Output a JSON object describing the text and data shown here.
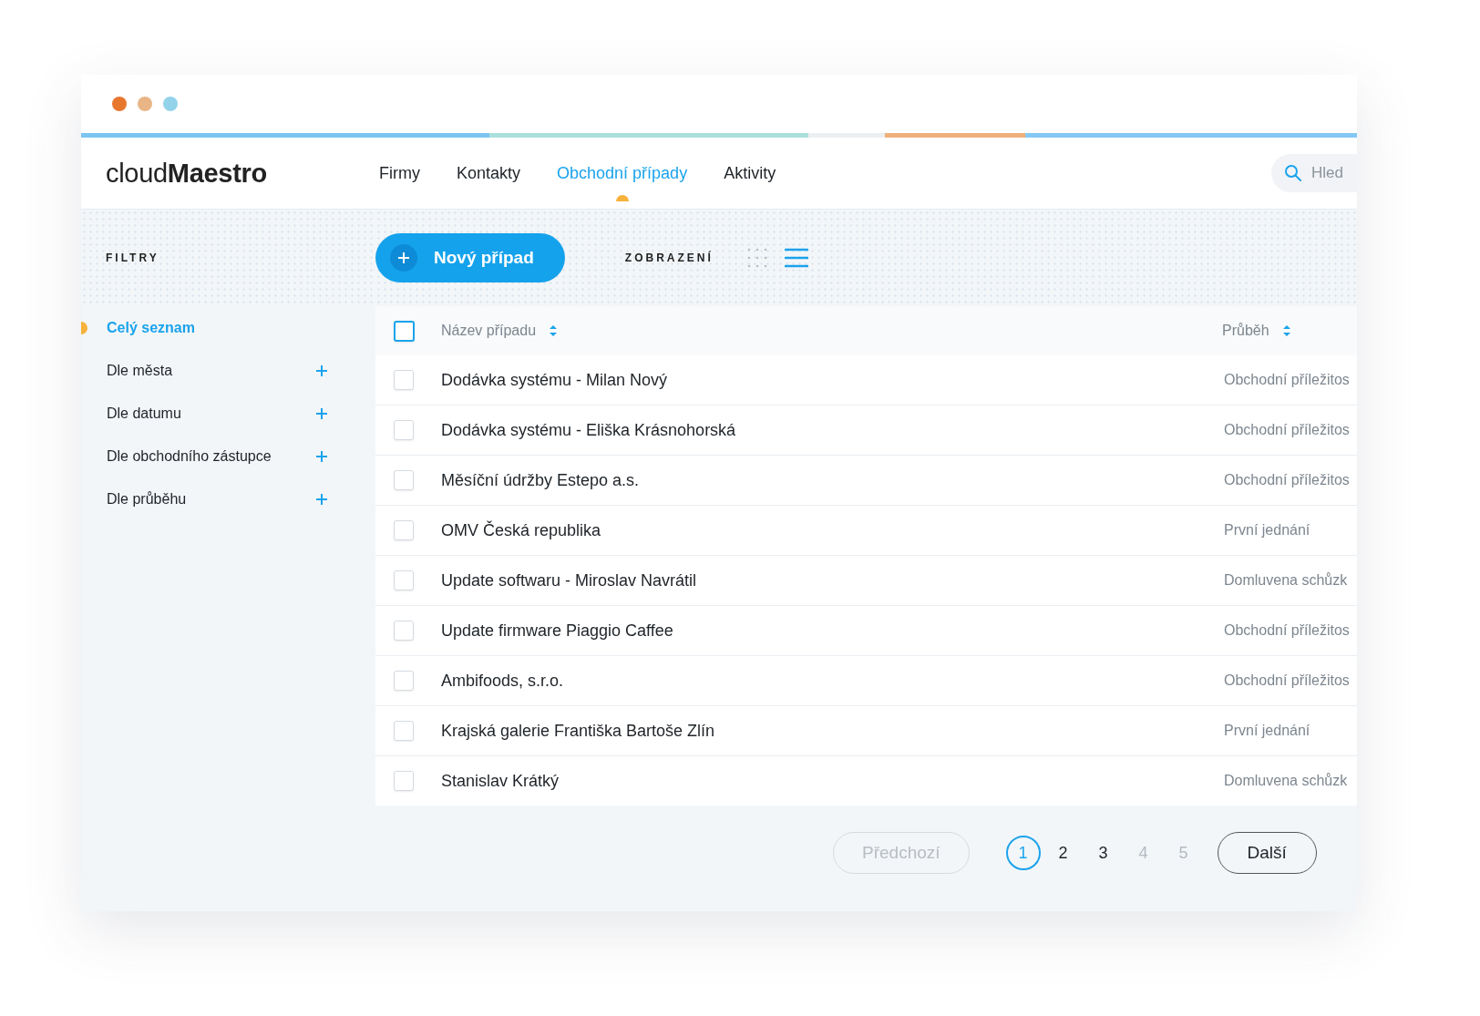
{
  "window": {
    "controls": [
      {
        "color": "#e8772e"
      },
      {
        "color": "#e9b587"
      },
      {
        "color": "#93d3ea"
      }
    ]
  },
  "header": {
    "logo_light": "cloud",
    "logo_bold": "Maestro",
    "nav": [
      {
        "label": "Firmy",
        "selected": false
      },
      {
        "label": "Kontakty",
        "selected": false
      },
      {
        "label": "Obchodní případy",
        "selected": true
      },
      {
        "label": "Aktivity",
        "selected": false
      }
    ],
    "search": {
      "placeholder": "Hled"
    }
  },
  "toolbar": {
    "filters_title": "FILTRY",
    "new_button": "Nový případ",
    "view_label": "ZOBRAZENÍ",
    "views": [
      {
        "kind": "grid",
        "selected": false
      },
      {
        "kind": "list",
        "selected": true
      }
    ]
  },
  "sidebar": {
    "items": [
      {
        "label": "Celý seznam",
        "kind": "all",
        "selected": true
      },
      {
        "label": "Dle města",
        "kind": "group",
        "selected": false
      },
      {
        "label": "Dle datumu",
        "kind": "group",
        "selected": false
      },
      {
        "label": "Dle obchodního zástupce",
        "kind": "group",
        "selected": false
      },
      {
        "label": "Dle průběhu",
        "kind": "group",
        "selected": false
      }
    ]
  },
  "table": {
    "select_all_checked": false,
    "columns": [
      "Název případu",
      "Průběh"
    ],
    "rows": [
      {
        "name": "Dodávka systému - Milan Nový",
        "progress": "Obchodní příležitos",
        "checked": false
      },
      {
        "name": "Dodávka systému - Eliška Krásnohorská",
        "progress": "Obchodní příležitos",
        "checked": false
      },
      {
        "name": "Měsíční údržby Estepo a.s.",
        "progress": "Obchodní příležitos",
        "checked": false
      },
      {
        "name": "OMV Česká republika",
        "progress": "První jednání",
        "checked": false
      },
      {
        "name": "Update softwaru - Miroslav Navrátil",
        "progress": "Domluvena schůzk",
        "checked": false
      },
      {
        "name": "Update firmware Piaggio Caffee",
        "progress": "Obchodní příležitos",
        "checked": false
      },
      {
        "name": "Ambifoods, s.r.o.",
        "progress": "Obchodní příležitos",
        "checked": false
      },
      {
        "name": "Krajská galerie Františka Bartoše Zlín",
        "progress": "První jednání",
        "checked": false
      },
      {
        "name": "Stanislav Krátký",
        "progress": "Domluvena schůzk",
        "checked": false
      }
    ]
  },
  "pagination": {
    "previous": {
      "label": "Předchozí",
      "disabled": true
    },
    "pages": [
      {
        "label": "1",
        "selected": true,
        "disabled": false
      },
      {
        "label": "2",
        "selected": false,
        "disabled": false
      },
      {
        "label": "3",
        "selected": false,
        "disabled": false
      },
      {
        "label": "4",
        "selected": false,
        "disabled": true
      },
      {
        "label": "5",
        "selected": false,
        "disabled": true
      }
    ],
    "next": {
      "label": "Další",
      "disabled": false
    }
  }
}
